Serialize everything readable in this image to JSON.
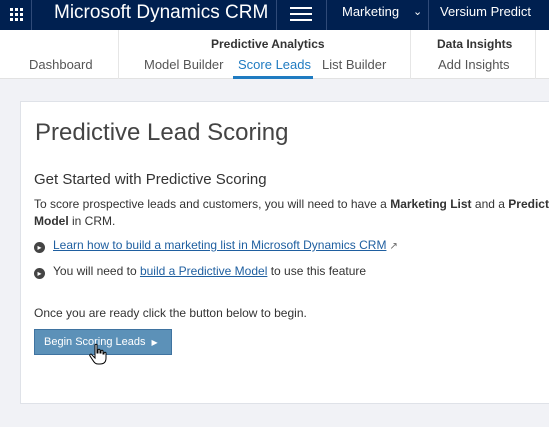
{
  "topbar": {
    "app_title": "Microsoft Dynamics CRM",
    "area": "Marketing",
    "sub_area": "Versium Predict",
    "icons": [
      "app-launcher-icon",
      "hamburger-menu-icon",
      "chevron-down-icon"
    ]
  },
  "subnav": {
    "dashboard": "Dashboard",
    "predictive_group": {
      "title": "Predictive Analytics",
      "links": [
        "Model Builder",
        "Score Leads",
        "List Builder"
      ],
      "active": "Score Leads"
    },
    "data_group": {
      "title": "Data Insights",
      "links": [
        "Add Insights"
      ]
    }
  },
  "main": {
    "title": "Predictive Lead Scoring",
    "section_title": "Get Started with Predictive Scoring",
    "intro": {
      "prefix": "To score prospective leads and customers, you will need to have a ",
      "bold1": "Marketing List",
      "middle": " and a ",
      "bold2": "Predictive Model",
      "suffix": " in CRM."
    },
    "bullets": [
      {
        "link": "Learn how to build a marketing list in Microsoft Dynamics CRM"
      },
      {
        "prefix": "You will need to ",
        "link": "build a Predictive Model",
        "suffix": " to use this feature"
      }
    ],
    "ready_text": "Once you are ready click the button below to begin.",
    "button_label": "Begin Scoring Leads"
  },
  "colors": {
    "topbar": "#002050",
    "accent": "#1f7bc1",
    "button": "#5c91b8",
    "link": "#1f5fa0"
  }
}
